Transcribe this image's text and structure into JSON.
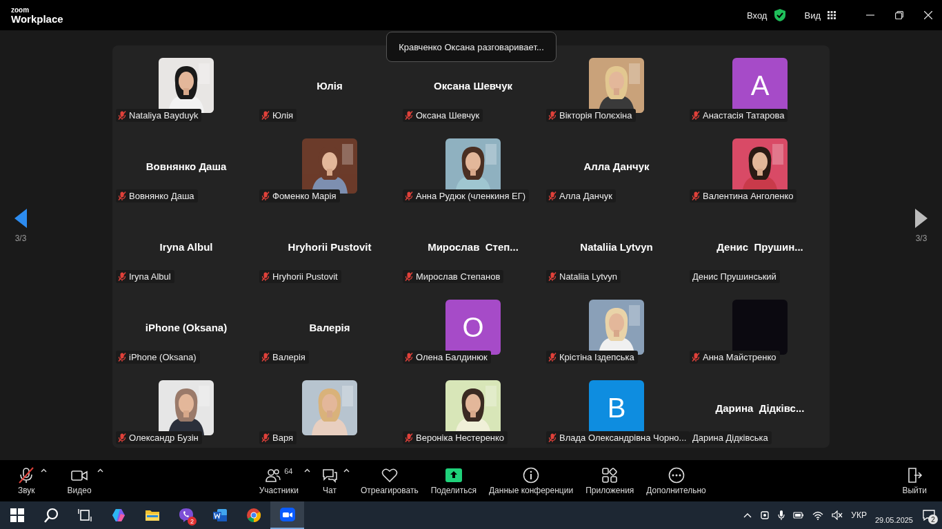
{
  "app": {
    "logo_top": "zoom",
    "logo_bottom": "Workplace"
  },
  "header": {
    "signin": "Вход",
    "view": "Вид"
  },
  "toast": "Кравченко Оксана разговаривает...",
  "pager": {
    "left": "3/3",
    "right": "3/3"
  },
  "participants": [
    {
      "name": "Nataliya Bayduyk",
      "muted": true
    },
    {
      "display": {
        "kind": "name",
        "text": "Юлія"
      },
      "name": "Юлія",
      "muted": true
    },
    {
      "display": {
        "kind": "name",
        "text": "Оксана Шевчук"
      },
      "name": "Оксана Шевчук",
      "muted": true
    },
    {
      "name": "Вікторія Полєхіна",
      "muted": true
    },
    {
      "display": {
        "kind": "letter",
        "text": "A",
        "color": "#a64bc8"
      },
      "name": "Анастасія Татарова",
      "muted": true
    },
    {
      "display": {
        "kind": "name",
        "text": "Вовнянко Даша"
      },
      "name": "Вовнянко Даша",
      "muted": true
    },
    {
      "name": "Фоменко Марія",
      "muted": true
    },
    {
      "name": "Анна Рудюк (членкиня ЕГ)",
      "muted": true
    },
    {
      "display": {
        "kind": "name",
        "text": "Алла Данчук"
      },
      "name": "Алла Данчук",
      "muted": true
    },
    {
      "name": "Валентина Анголенко",
      "muted": true
    },
    {
      "display": {
        "kind": "name",
        "text": "Iryna Albul"
      },
      "name": "Iryna Albul",
      "muted": true
    },
    {
      "display": {
        "kind": "name",
        "text": "Hryhorii Pustovit"
      },
      "name": "Hryhorii Pustovit",
      "muted": true
    },
    {
      "display": {
        "kind": "name",
        "text": "Мирослав  Степ..."
      },
      "name": "Мирослав Степанов",
      "muted": true
    },
    {
      "display": {
        "kind": "name",
        "text": "Nataliia Lytvyn"
      },
      "name": "Nataliia Lytvyn",
      "muted": true
    },
    {
      "display": {
        "kind": "name",
        "text": "Денис  Прушин..."
      },
      "name": "Денис Прушинський",
      "muted": false
    },
    {
      "display": {
        "kind": "name",
        "text": "iPhone (Oksana)"
      },
      "name": "iPhone (Oksana)",
      "muted": true
    },
    {
      "display": {
        "kind": "name",
        "text": "Валерія"
      },
      "name": "Валерія",
      "muted": true
    },
    {
      "display": {
        "kind": "letter",
        "text": "O",
        "color": "#a64bc8"
      },
      "name": "Олена Балдинюк",
      "muted": true
    },
    {
      "name": "Крістіна Іздепська",
      "muted": true
    },
    {
      "display": {
        "kind": "dark"
      },
      "name": "Анна Майстренко",
      "muted": true
    },
    {
      "name": "Олександр Бузін",
      "muted": true
    },
    {
      "name": "Варя",
      "muted": true
    },
    {
      "name": "Вероніка Нестеренко",
      "muted": true
    },
    {
      "display": {
        "kind": "letter",
        "text": "B",
        "color": "#0e8de0"
      },
      "name": "Влада Олександрівна Чорно...",
      "muted": true
    },
    {
      "display": {
        "kind": "name",
        "text": "Дарина  Дідківс..."
      },
      "name": "Дарина Дідківська",
      "muted": false
    }
  ],
  "toolbar_left": [
    {
      "kind": "mic",
      "label": "Звук",
      "muted": true,
      "caret": true
    },
    {
      "kind": "video",
      "label": "Видео",
      "caret": true
    }
  ],
  "toolbar_center": [
    {
      "kind": "participants",
      "label": "Участники",
      "count": "64",
      "caret": true
    },
    {
      "kind": "chat",
      "label": "Чат",
      "caret": true
    },
    {
      "kind": "react",
      "label": "Отреагировать"
    },
    {
      "kind": "share",
      "label": "Поделиться"
    },
    {
      "kind": "info",
      "label": "Данные конференции"
    },
    {
      "kind": "apps",
      "label": "Приложения"
    },
    {
      "kind": "more",
      "label": "Дополнительно"
    }
  ],
  "toolbar_right": [
    {
      "kind": "leave",
      "label": "Выйти"
    }
  ],
  "taskbar": {
    "apps": [
      {
        "kind": "start",
        "selected": false
      },
      {
        "kind": "search",
        "selected": false
      },
      {
        "kind": "taskview",
        "selected": false
      },
      {
        "kind": "copilot",
        "selected": false
      },
      {
        "kind": "explorer",
        "selected": false
      },
      {
        "kind": "viber",
        "selected": false,
        "badge": "2"
      },
      {
        "kind": "word",
        "selected": false
      },
      {
        "kind": "chrome",
        "selected": false
      },
      {
        "kind": "zoom",
        "selected": true
      }
    ],
    "language": "УКР",
    "date": "29.05.2025",
    "notifications": "2"
  }
}
